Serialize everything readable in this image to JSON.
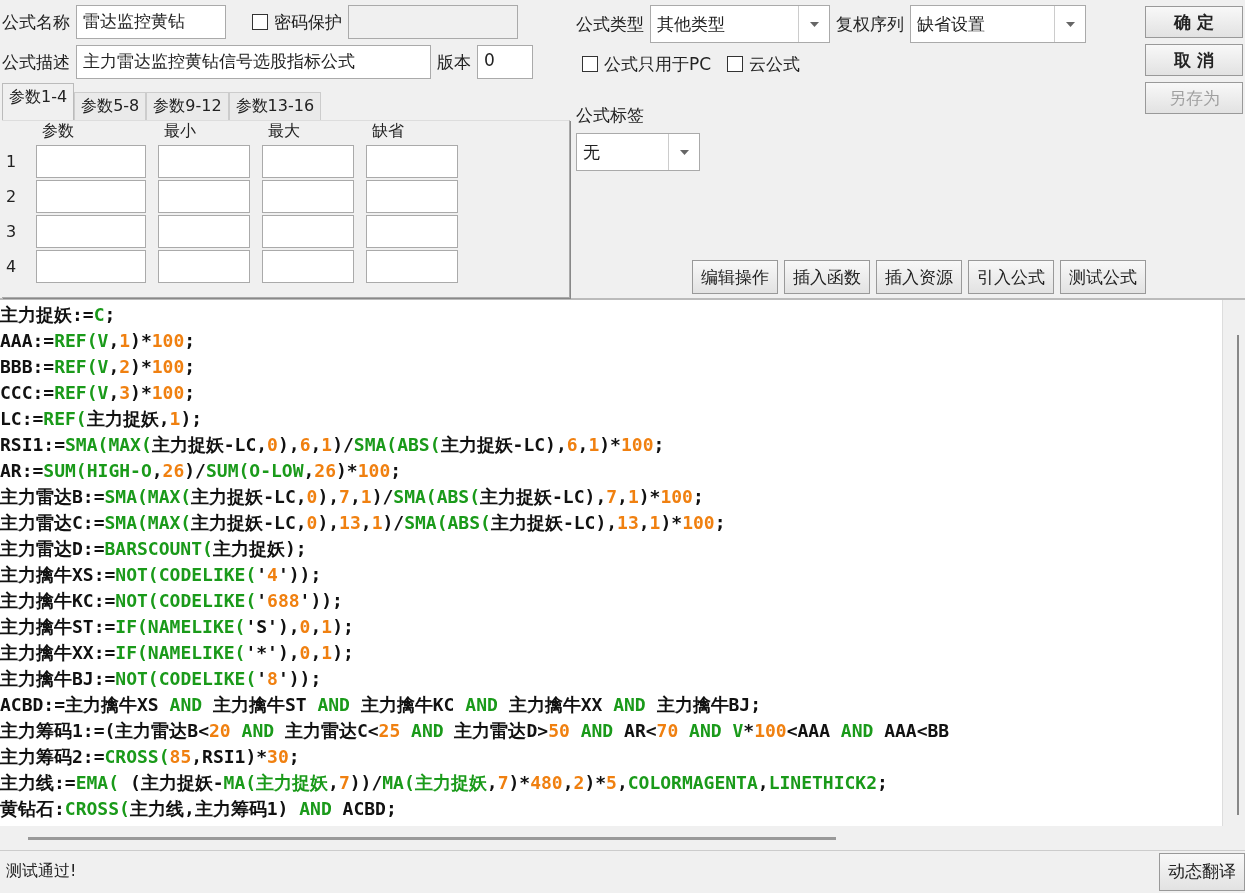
{
  "form": {
    "name_label": "公式名称",
    "name_value": "雷达监控黄钻",
    "password": {
      "label": "密码保护",
      "checked": false
    },
    "desc_label": "公式描述",
    "desc_value": "主力雷达监控黄钻信号选股指标公式",
    "version_label": "版本",
    "version_value": "0"
  },
  "params": {
    "tabs": [
      {
        "label": "参数1-4",
        "selected": true
      },
      {
        "label": "参数5-8",
        "selected": false
      },
      {
        "label": "参数9-12",
        "selected": false
      },
      {
        "label": "参数13-16",
        "selected": false
      }
    ],
    "columns": [
      "参数",
      "最小",
      "最大",
      "缺省"
    ],
    "rows": [
      "1",
      "2",
      "3",
      "4"
    ]
  },
  "formula_type": {
    "label": "公式类型",
    "value": "其他类型"
  },
  "rights_series": {
    "label": "复权序列",
    "value": "缺省设置"
  },
  "options": [
    {
      "label": "公式只用于PC",
      "checked": false
    },
    {
      "label": "云公式",
      "checked": false
    }
  ],
  "formula_tag": {
    "label": "公式标签",
    "value": "无"
  },
  "side_buttons": [
    {
      "label": "确 定",
      "disabled": false
    },
    {
      "label": "取 消",
      "disabled": false
    },
    {
      "label": "另存为",
      "disabled": true
    }
  ],
  "tool_buttons": [
    "编辑操作",
    "插入函数",
    "插入资源",
    "引入公式",
    "测试公式"
  ],
  "code": [
    [
      {
        "kind": "t",
        "text": "主力捉妖:="
      },
      {
        "kind": "f",
        "text": "C"
      },
      {
        "kind": "t",
        "text": ";"
      }
    ],
    [
      {
        "kind": "t",
        "text": "AAA:="
      },
      {
        "kind": "f",
        "text": "REF(V"
      },
      {
        "kind": "t",
        "text": ","
      },
      {
        "kind": "n",
        "text": "1"
      },
      {
        "kind": "t",
        "text": ")*"
      },
      {
        "kind": "n",
        "text": "100"
      },
      {
        "kind": "t",
        "text": ";"
      }
    ],
    [
      {
        "kind": "t",
        "text": "BBB:="
      },
      {
        "kind": "f",
        "text": "REF(V"
      },
      {
        "kind": "t",
        "text": ","
      },
      {
        "kind": "n",
        "text": "2"
      },
      {
        "kind": "t",
        "text": ")*"
      },
      {
        "kind": "n",
        "text": "100"
      },
      {
        "kind": "t",
        "text": ";"
      }
    ],
    [
      {
        "kind": "t",
        "text": "CCC:="
      },
      {
        "kind": "f",
        "text": "REF(V"
      },
      {
        "kind": "t",
        "text": ","
      },
      {
        "kind": "n",
        "text": "3"
      },
      {
        "kind": "t",
        "text": ")*"
      },
      {
        "kind": "n",
        "text": "100"
      },
      {
        "kind": "t",
        "text": ";"
      }
    ],
    [
      {
        "kind": "t",
        "text": "LC:="
      },
      {
        "kind": "f",
        "text": "REF("
      },
      {
        "kind": "t",
        "text": "主力捉妖,"
      },
      {
        "kind": "n",
        "text": "1"
      },
      {
        "kind": "t",
        "text": ");"
      }
    ],
    [
      {
        "kind": "t",
        "text": "RSI1:="
      },
      {
        "kind": "f",
        "text": "SMA(MAX("
      },
      {
        "kind": "t",
        "text": "主力捉妖-LC,"
      },
      {
        "kind": "n",
        "text": "0"
      },
      {
        "kind": "t",
        "text": "),"
      },
      {
        "kind": "n",
        "text": "6"
      },
      {
        "kind": "t",
        "text": ","
      },
      {
        "kind": "n",
        "text": "1"
      },
      {
        "kind": "t",
        "text": ")/"
      },
      {
        "kind": "f",
        "text": "SMA(ABS("
      },
      {
        "kind": "t",
        "text": "主力捉妖-LC),"
      },
      {
        "kind": "n",
        "text": "6"
      },
      {
        "kind": "t",
        "text": ","
      },
      {
        "kind": "n",
        "text": "1"
      },
      {
        "kind": "t",
        "text": ")*"
      },
      {
        "kind": "n",
        "text": "100"
      },
      {
        "kind": "t",
        "text": ";"
      }
    ],
    [
      {
        "kind": "t",
        "text": "AR:="
      },
      {
        "kind": "f",
        "text": "SUM(HIGH-O"
      },
      {
        "kind": "t",
        "text": ","
      },
      {
        "kind": "n",
        "text": "26"
      },
      {
        "kind": "t",
        "text": ")/"
      },
      {
        "kind": "f",
        "text": "SUM(O-LOW"
      },
      {
        "kind": "t",
        "text": ","
      },
      {
        "kind": "n",
        "text": "26"
      },
      {
        "kind": "t",
        "text": ")*"
      },
      {
        "kind": "n",
        "text": "100"
      },
      {
        "kind": "t",
        "text": ";"
      }
    ],
    [
      {
        "kind": "t",
        "text": "主力雷达B:="
      },
      {
        "kind": "f",
        "text": "SMA(MAX("
      },
      {
        "kind": "t",
        "text": "主力捉妖-LC,"
      },
      {
        "kind": "n",
        "text": "0"
      },
      {
        "kind": "t",
        "text": "),"
      },
      {
        "kind": "n",
        "text": "7"
      },
      {
        "kind": "t",
        "text": ","
      },
      {
        "kind": "n",
        "text": "1"
      },
      {
        "kind": "t",
        "text": ")/"
      },
      {
        "kind": "f",
        "text": "SMA(ABS("
      },
      {
        "kind": "t",
        "text": "主力捉妖-LC),"
      },
      {
        "kind": "n",
        "text": "7"
      },
      {
        "kind": "t",
        "text": ","
      },
      {
        "kind": "n",
        "text": "1"
      },
      {
        "kind": "t",
        "text": ")*"
      },
      {
        "kind": "n",
        "text": "100"
      },
      {
        "kind": "t",
        "text": ";"
      }
    ],
    [
      {
        "kind": "t",
        "text": "主力雷达C:="
      },
      {
        "kind": "f",
        "text": "SMA(MAX("
      },
      {
        "kind": "t",
        "text": "主力捉妖-LC,"
      },
      {
        "kind": "n",
        "text": "0"
      },
      {
        "kind": "t",
        "text": "),"
      },
      {
        "kind": "n",
        "text": "13"
      },
      {
        "kind": "t",
        "text": ","
      },
      {
        "kind": "n",
        "text": "1"
      },
      {
        "kind": "t",
        "text": ")/"
      },
      {
        "kind": "f",
        "text": "SMA(ABS("
      },
      {
        "kind": "t",
        "text": "主力捉妖-LC),"
      },
      {
        "kind": "n",
        "text": "13"
      },
      {
        "kind": "t",
        "text": ","
      },
      {
        "kind": "n",
        "text": "1"
      },
      {
        "kind": "t",
        "text": ")*"
      },
      {
        "kind": "n",
        "text": "100"
      },
      {
        "kind": "t",
        "text": ";"
      }
    ],
    [
      {
        "kind": "t",
        "text": "主力雷达D:="
      },
      {
        "kind": "f",
        "text": "BARSCOUNT("
      },
      {
        "kind": "t",
        "text": "主力捉妖);"
      }
    ],
    [
      {
        "kind": "t",
        "text": "主力擒牛XS:="
      },
      {
        "kind": "f",
        "text": "NOT(CODELIKE("
      },
      {
        "kind": "t",
        "text": "'"
      },
      {
        "kind": "n",
        "text": "4"
      },
      {
        "kind": "t",
        "text": "'));"
      }
    ],
    [
      {
        "kind": "t",
        "text": "主力擒牛KC:="
      },
      {
        "kind": "f",
        "text": "NOT(CODELIKE("
      },
      {
        "kind": "t",
        "text": "'"
      },
      {
        "kind": "n",
        "text": "688"
      },
      {
        "kind": "t",
        "text": "'));"
      }
    ],
    [
      {
        "kind": "t",
        "text": "主力擒牛ST:="
      },
      {
        "kind": "f",
        "text": "IF(NAMELIKE("
      },
      {
        "kind": "t",
        "text": "'S'),"
      },
      {
        "kind": "n",
        "text": "0"
      },
      {
        "kind": "t",
        "text": ","
      },
      {
        "kind": "n",
        "text": "1"
      },
      {
        "kind": "t",
        "text": ");"
      }
    ],
    [
      {
        "kind": "t",
        "text": "主力擒牛XX:="
      },
      {
        "kind": "f",
        "text": "IF(NAMELIKE("
      },
      {
        "kind": "t",
        "text": "'*'),"
      },
      {
        "kind": "n",
        "text": "0"
      },
      {
        "kind": "t",
        "text": ","
      },
      {
        "kind": "n",
        "text": "1"
      },
      {
        "kind": "t",
        "text": ");"
      }
    ],
    [
      {
        "kind": "t",
        "text": "主力擒牛BJ:="
      },
      {
        "kind": "f",
        "text": "NOT(CODELIKE("
      },
      {
        "kind": "t",
        "text": "'"
      },
      {
        "kind": "n",
        "text": "8"
      },
      {
        "kind": "t",
        "text": "'));"
      }
    ],
    [
      {
        "kind": "t",
        "text": "ACBD:=主力擒牛XS "
      },
      {
        "kind": "f",
        "text": "AND"
      },
      {
        "kind": "t",
        "text": " 主力擒牛ST "
      },
      {
        "kind": "f",
        "text": "AND"
      },
      {
        "kind": "t",
        "text": " 主力擒牛KC "
      },
      {
        "kind": "f",
        "text": "AND"
      },
      {
        "kind": "t",
        "text": " 主力擒牛XX "
      },
      {
        "kind": "f",
        "text": "AND"
      },
      {
        "kind": "t",
        "text": " 主力擒牛BJ;"
      }
    ],
    [
      {
        "kind": "t",
        "text": "主力筹码1:=(主力雷达B<"
      },
      {
        "kind": "n",
        "text": "20"
      },
      {
        "kind": "f",
        "text": " AND"
      },
      {
        "kind": "t",
        "text": " 主力雷达C<"
      },
      {
        "kind": "n",
        "text": "25"
      },
      {
        "kind": "f",
        "text": " AND"
      },
      {
        "kind": "t",
        "text": " 主力雷达D>"
      },
      {
        "kind": "n",
        "text": "50"
      },
      {
        "kind": "f",
        "text": " AND"
      },
      {
        "kind": "t",
        "text": " AR<"
      },
      {
        "kind": "n",
        "text": "70"
      },
      {
        "kind": "f",
        "text": " AND V"
      },
      {
        "kind": "t",
        "text": "*"
      },
      {
        "kind": "n",
        "text": "100"
      },
      {
        "kind": "t",
        "text": "<AAA "
      },
      {
        "kind": "f",
        "text": "AND"
      },
      {
        "kind": "t",
        "text": " AAA<BB"
      }
    ],
    [
      {
        "kind": "t",
        "text": "主力筹码2:="
      },
      {
        "kind": "f",
        "text": "CROSS("
      },
      {
        "kind": "n",
        "text": "85"
      },
      {
        "kind": "t",
        "text": ",RSI1)*"
      },
      {
        "kind": "n",
        "text": "30"
      },
      {
        "kind": "t",
        "text": ";"
      }
    ],
    [
      {
        "kind": "t",
        "text": "主力线:="
      },
      {
        "kind": "f",
        "text": "EMA("
      },
      {
        "kind": "t",
        "text": " (主力捉妖-"
      },
      {
        "kind": "f",
        "text": "MA(主力捉妖"
      },
      {
        "kind": "t",
        "text": ","
      },
      {
        "kind": "n",
        "text": "7"
      },
      {
        "kind": "t",
        "text": "))/"
      },
      {
        "kind": "f",
        "text": "MA(主力捉妖"
      },
      {
        "kind": "t",
        "text": ","
      },
      {
        "kind": "n",
        "text": "7"
      },
      {
        "kind": "t",
        "text": ")*"
      },
      {
        "kind": "n",
        "text": "480"
      },
      {
        "kind": "t",
        "text": ","
      },
      {
        "kind": "n",
        "text": "2"
      },
      {
        "kind": "t",
        "text": ")*"
      },
      {
        "kind": "n",
        "text": "5"
      },
      {
        "kind": "t",
        "text": ","
      },
      {
        "kind": "f",
        "text": "COLORMAGENTA"
      },
      {
        "kind": "t",
        "text": ","
      },
      {
        "kind": "f",
        "text": "LINETHICK2"
      },
      {
        "kind": "t",
        "text": ";"
      }
    ],
    [
      {
        "kind": "t",
        "text": "黄钻石:"
      },
      {
        "kind": "f",
        "text": "CROSS("
      },
      {
        "kind": "t",
        "text": "主力线,主力筹码1) "
      },
      {
        "kind": "f",
        "text": "AND"
      },
      {
        "kind": "t",
        "text": " ACBD;"
      }
    ]
  ],
  "status": "测试通过!",
  "translate_button": "动态翻译"
}
